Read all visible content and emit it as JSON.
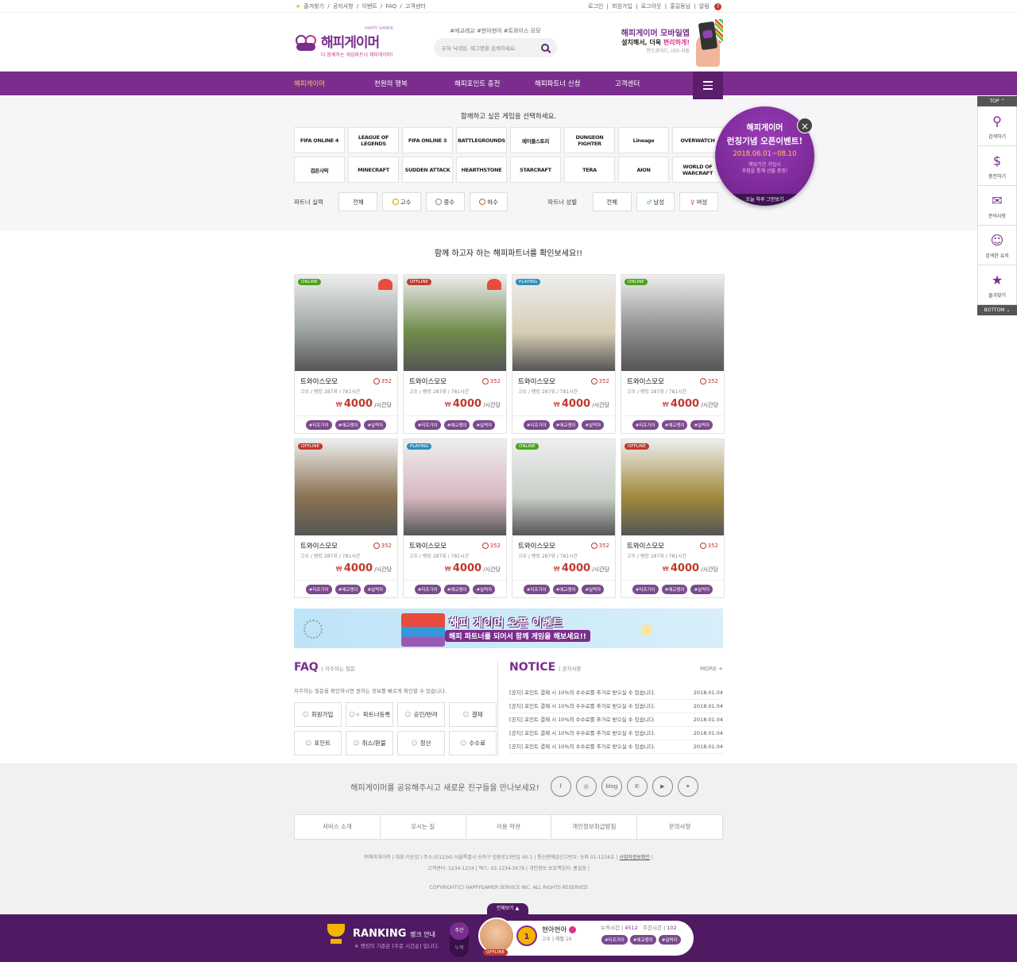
{
  "topbar": {
    "left": [
      "즐겨찾기",
      "공지사항",
      "이벤트",
      "FAQ",
      "고객센터"
    ],
    "right": [
      "로그인",
      "회원가입",
      "로그아웃",
      "홍길동님",
      "알림"
    ],
    "alarm_count": "7"
  },
  "header": {
    "logo_name": "해피게이머",
    "logo_eng": "HAPPY GAMER",
    "logo_sub": "다 함께하는 게임파트너 해피게이머!",
    "tags": "#애교레교 #현아현아 #트와이스 모모",
    "search_placeholder": "유저 닉네임, 태그명을 검색하세요.",
    "app_line1": "해피게이머 모바일앱",
    "app_line2_a": "설치해서, 더욱 ",
    "app_line2_b": "편리하게!",
    "app_line3": "안드로이드, iOS 지원"
  },
  "nav": {
    "items": [
      "해피게이머",
      "천원의 행복",
      "해피포인트 충전",
      "해피파트너 신청",
      "고객센터"
    ]
  },
  "games": {
    "title": "함께하고 싶은 게임을 선택하세요.",
    "list": [
      "FIFA ONLINE 4",
      "LEAGUE OF LEGENDS",
      "FIFA ONLINE 3",
      "BATTLEGROUNDS",
      "메이플스토리",
      "DUNGEON FIGHTER",
      "Lineage",
      "OVERWATCH",
      "검은사막",
      "MINECRAFT",
      "SUDDEN ATTACK",
      "HEARTHSTONE",
      "STARCRAFT",
      "TERA",
      "AION",
      "WORLD OF WARCRAFT"
    ]
  },
  "filters": {
    "skill_label": "파트너 실력",
    "skill_options": [
      "전체",
      "고수",
      "중수",
      "하수"
    ],
    "gender_label": "파트너 성별",
    "gender_options": [
      "전체",
      "남성",
      "여성"
    ]
  },
  "popup": {
    "logo": "해피게이머",
    "title": "런칭기념 오픈이벤트!",
    "date": "2018.06.01~08.10",
    "msg1": "해당기간 가입시",
    "msg2": "추첨을 통해 선물 증정!",
    "footer": "오늘 하루 그만보기"
  },
  "partners": {
    "title": "함께 하고자 하는 해피파트너를 확인보세요!!",
    "cards": [
      {
        "status": "ONLINE",
        "name": "트와이스모모",
        "likes": "352",
        "meta": "고수 / 랭킹 287위 / 781시간",
        "price": "4000",
        "currency": "₩",
        "unit": "/시간당",
        "tags": [
          "#티프가이",
          "#애교쟁이",
          "#실력자"
        ],
        "bg": "#9aa0a0",
        "badge": true
      },
      {
        "status": "OFFLINE",
        "name": "트와이스모모",
        "likes": "352",
        "meta": "고수 / 랭킹 287위 / 781시간",
        "price": "4000",
        "currency": "₩",
        "unit": "/시간당",
        "tags": [
          "#티프가이",
          "#애교쟁이",
          "#실력자"
        ],
        "bg": "#6f8a4a",
        "badge": true
      },
      {
        "status": "PLAYING",
        "name": "트와이스모모",
        "likes": "352",
        "meta": "고수 / 랭킹 287위 / 781시간",
        "price": "4000",
        "currency": "₩",
        "unit": "/시간당",
        "tags": [
          "#티프가이",
          "#애교쟁이",
          "#실력자"
        ],
        "bg": "#d8cdb4",
        "badge": false
      },
      {
        "status": "ONLINE",
        "name": "트와이스모모",
        "likes": "352",
        "meta": "고수 / 랭킹 287위 / 781시간",
        "price": "4000",
        "currency": "₩",
        "unit": "/시간당",
        "tags": [
          "#티프가이",
          "#애교쟁이",
          "#실력자"
        ],
        "bg": "#8a8a8a",
        "badge": false
      },
      {
        "status": "OFFLINE",
        "name": "트와이스모모",
        "likes": "352",
        "meta": "고수 / 랭킹 287위 / 781시간",
        "price": "4000",
        "currency": "₩",
        "unit": "/시간당",
        "tags": [
          "#티프가이",
          "#애교쟁이",
          "#실력자"
        ],
        "bg": "#8a7352",
        "badge": false
      },
      {
        "status": "PLAYING",
        "name": "트와이스모모",
        "likes": "352",
        "meta": "고수 / 랭킹 287위 / 781시간",
        "price": "4000",
        "currency": "₩",
        "unit": "/시간당",
        "tags": [
          "#티프가이",
          "#애교쟁이",
          "#실력자"
        ],
        "bg": "#d7b8c0",
        "badge": false
      },
      {
        "status": "ONLINE",
        "name": "트와이스모모",
        "likes": "352",
        "meta": "고수 / 랭킹 287위 / 781시간",
        "price": "4000",
        "currency": "₩",
        "unit": "/시간당",
        "tags": [
          "#티프가이",
          "#애교쟁이",
          "#실력자"
        ],
        "bg": "#c9cfc9",
        "badge": false
      },
      {
        "status": "OFFLINE",
        "name": "트와이스모모",
        "likes": "352",
        "meta": "고수 / 랭킹 287위 / 781시간",
        "price": "4000",
        "currency": "₩",
        "unit": "/시간당",
        "tags": [
          "#티프가이",
          "#애교쟁이",
          "#실력자"
        ],
        "bg": "#a08a3a",
        "badge": false
      }
    ]
  },
  "banner": {
    "line1": "해피 게이머 오픈 이벤트",
    "line2": "해피 파트너를 되어서 함께 게임을 해보세요!!"
  },
  "faq": {
    "title": "FAQ",
    "sub": "자주하는 질문",
    "desc": "자주하는 질문을 확인하시면 원하는 정보를 빠르게 확인할 수 있습니다.",
    "buttons": [
      "회원가입",
      "파트너등록",
      "승인/반려",
      "결제",
      "포인트",
      "취소/환불",
      "정산",
      "수수료"
    ]
  },
  "notice": {
    "title": "NOTICE",
    "sub": "공지사항",
    "more": "MORE +",
    "items": [
      {
        "text": "[공지] 포인트 결제 시 10%의 수수료를 추가로 받으실 수 있습니다.",
        "date": "2018.01.04"
      },
      {
        "text": "[공지] 포인트 결제 시 10%의 수수료를 추가로 받으실 수 있습니다.",
        "date": "2018.01.04"
      },
      {
        "text": "[공지] 포인트 결제 시 10%의 수수료를 추가로 받으실 수 있습니다.",
        "date": "2018.01.04"
      },
      {
        "text": "[공지] 포인트 결제 시 10%의 수수료를 추가로 받으실 수 있습니다.",
        "date": "2018.01.04"
      },
      {
        "text": "[공지] 포인트 결제 시 10%의 수수료를 추가로 받으실 수 있습니다.",
        "date": "2018.01.04"
      }
    ]
  },
  "footer": {
    "share_text": "해피게이머를 공유해주시고 새로운 친구들을 만나보세요!",
    "social": [
      "f",
      "◎",
      "blog",
      "✆",
      "▶",
      "✦"
    ],
    "nav": [
      "서비스 소개",
      "오시는 길",
      "이용 약관",
      "개인정보취급방침",
      "문의사항"
    ],
    "info1": "㈜해피게이머 | 대표:이순업 | 주소:(01234) 서울특별시 송파구 법원로23번길 40-1 | 통신판매업신고번호: 송파 01-1234호 |",
    "info1_link": "사업자정보확인",
    "info2": "고객센터: 1234-1234 | 팩스: 02-1234-5678 | 개인정보 보호책임자: 홍길동 |",
    "copy": "COPYRIGHT(C) HAPPYGAMER SERVICE INC. ALL RIGHTS RESERVED"
  },
  "ranking": {
    "tab": "전체보기 ▲",
    "title": "RANKING",
    "title_sub": "랭크 안내",
    "note": "※ 랭킹의 기준은 [주문 시간순] 입니다.",
    "period_a": "주간",
    "period_b": "누적",
    "status": "OFFLINE",
    "rank": "1",
    "name": "현아현아",
    "level": "고수 | 레벨 10",
    "total_label": "누적시간 |",
    "total_value": "4512",
    "week_label": "주간시간 |",
    "week_value": "102",
    "tags": [
      "#티프가이",
      "#애교쟁이",
      "#실력자"
    ]
  },
  "quick": {
    "top": "TOP",
    "bottom": "BOTTOM",
    "items": [
      {
        "label": "검색하기",
        "glyph": "⚲"
      },
      {
        "label": "충전하기",
        "glyph": "$"
      },
      {
        "label": "문의사항",
        "glyph": "✉"
      },
      {
        "label": "검색한 유저",
        "glyph": "☺"
      },
      {
        "label": "즐겨찾기",
        "glyph": "★"
      }
    ]
  }
}
